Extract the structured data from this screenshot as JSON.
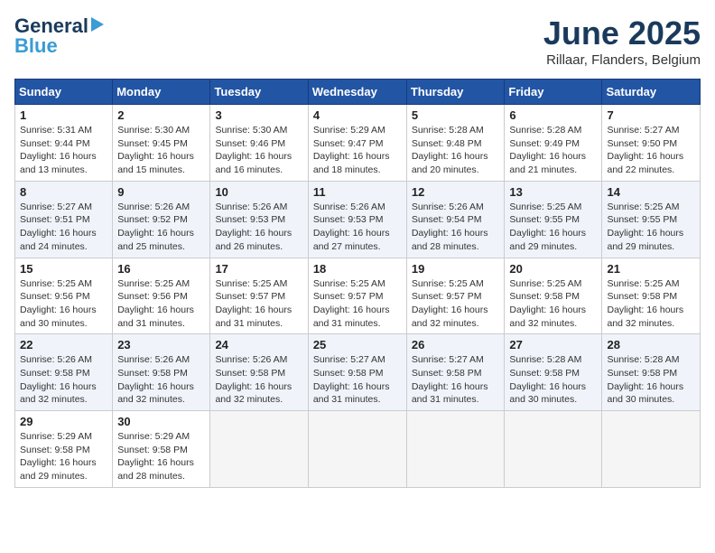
{
  "logo": {
    "line1": "General",
    "line2": "Blue"
  },
  "title": "June 2025",
  "subtitle": "Rillaar, Flanders, Belgium",
  "headers": [
    "Sunday",
    "Monday",
    "Tuesday",
    "Wednesday",
    "Thursday",
    "Friday",
    "Saturday"
  ],
  "weeks": [
    [
      {
        "day": "1",
        "sunrise": "5:31 AM",
        "sunset": "9:44 PM",
        "daylight": "16 hours and 13 minutes."
      },
      {
        "day": "2",
        "sunrise": "5:30 AM",
        "sunset": "9:45 PM",
        "daylight": "16 hours and 15 minutes."
      },
      {
        "day": "3",
        "sunrise": "5:30 AM",
        "sunset": "9:46 PM",
        "daylight": "16 hours and 16 minutes."
      },
      {
        "day": "4",
        "sunrise": "5:29 AM",
        "sunset": "9:47 PM",
        "daylight": "16 hours and 18 minutes."
      },
      {
        "day": "5",
        "sunrise": "5:28 AM",
        "sunset": "9:48 PM",
        "daylight": "16 hours and 20 minutes."
      },
      {
        "day": "6",
        "sunrise": "5:28 AM",
        "sunset": "9:49 PM",
        "daylight": "16 hours and 21 minutes."
      },
      {
        "day": "7",
        "sunrise": "5:27 AM",
        "sunset": "9:50 PM",
        "daylight": "16 hours and 22 minutes."
      }
    ],
    [
      {
        "day": "8",
        "sunrise": "5:27 AM",
        "sunset": "9:51 PM",
        "daylight": "16 hours and 24 minutes."
      },
      {
        "day": "9",
        "sunrise": "5:26 AM",
        "sunset": "9:52 PM",
        "daylight": "16 hours and 25 minutes."
      },
      {
        "day": "10",
        "sunrise": "5:26 AM",
        "sunset": "9:53 PM",
        "daylight": "16 hours and 26 minutes."
      },
      {
        "day": "11",
        "sunrise": "5:26 AM",
        "sunset": "9:53 PM",
        "daylight": "16 hours and 27 minutes."
      },
      {
        "day": "12",
        "sunrise": "5:26 AM",
        "sunset": "9:54 PM",
        "daylight": "16 hours and 28 minutes."
      },
      {
        "day": "13",
        "sunrise": "5:25 AM",
        "sunset": "9:55 PM",
        "daylight": "16 hours and 29 minutes."
      },
      {
        "day": "14",
        "sunrise": "5:25 AM",
        "sunset": "9:55 PM",
        "daylight": "16 hours and 29 minutes."
      }
    ],
    [
      {
        "day": "15",
        "sunrise": "5:25 AM",
        "sunset": "9:56 PM",
        "daylight": "16 hours and 30 minutes."
      },
      {
        "day": "16",
        "sunrise": "5:25 AM",
        "sunset": "9:56 PM",
        "daylight": "16 hours and 31 minutes."
      },
      {
        "day": "17",
        "sunrise": "5:25 AM",
        "sunset": "9:57 PM",
        "daylight": "16 hours and 31 minutes."
      },
      {
        "day": "18",
        "sunrise": "5:25 AM",
        "sunset": "9:57 PM",
        "daylight": "16 hours and 31 minutes."
      },
      {
        "day": "19",
        "sunrise": "5:25 AM",
        "sunset": "9:57 PM",
        "daylight": "16 hours and 32 minutes."
      },
      {
        "day": "20",
        "sunrise": "5:25 AM",
        "sunset": "9:58 PM",
        "daylight": "16 hours and 32 minutes."
      },
      {
        "day": "21",
        "sunrise": "5:25 AM",
        "sunset": "9:58 PM",
        "daylight": "16 hours and 32 minutes."
      }
    ],
    [
      {
        "day": "22",
        "sunrise": "5:26 AM",
        "sunset": "9:58 PM",
        "daylight": "16 hours and 32 minutes."
      },
      {
        "day": "23",
        "sunrise": "5:26 AM",
        "sunset": "9:58 PM",
        "daylight": "16 hours and 32 minutes."
      },
      {
        "day": "24",
        "sunrise": "5:26 AM",
        "sunset": "9:58 PM",
        "daylight": "16 hours and 32 minutes."
      },
      {
        "day": "25",
        "sunrise": "5:27 AM",
        "sunset": "9:58 PM",
        "daylight": "16 hours and 31 minutes."
      },
      {
        "day": "26",
        "sunrise": "5:27 AM",
        "sunset": "9:58 PM",
        "daylight": "16 hours and 31 minutes."
      },
      {
        "day": "27",
        "sunrise": "5:28 AM",
        "sunset": "9:58 PM",
        "daylight": "16 hours and 30 minutes."
      },
      {
        "day": "28",
        "sunrise": "5:28 AM",
        "sunset": "9:58 PM",
        "daylight": "16 hours and 30 minutes."
      }
    ],
    [
      {
        "day": "29",
        "sunrise": "5:29 AM",
        "sunset": "9:58 PM",
        "daylight": "16 hours and 29 minutes."
      },
      {
        "day": "30",
        "sunrise": "5:29 AM",
        "sunset": "9:58 PM",
        "daylight": "16 hours and 28 minutes."
      },
      null,
      null,
      null,
      null,
      null
    ]
  ],
  "labels": {
    "sunrise": "Sunrise: ",
    "sunset": "Sunset: ",
    "daylight": "Daylight: "
  }
}
